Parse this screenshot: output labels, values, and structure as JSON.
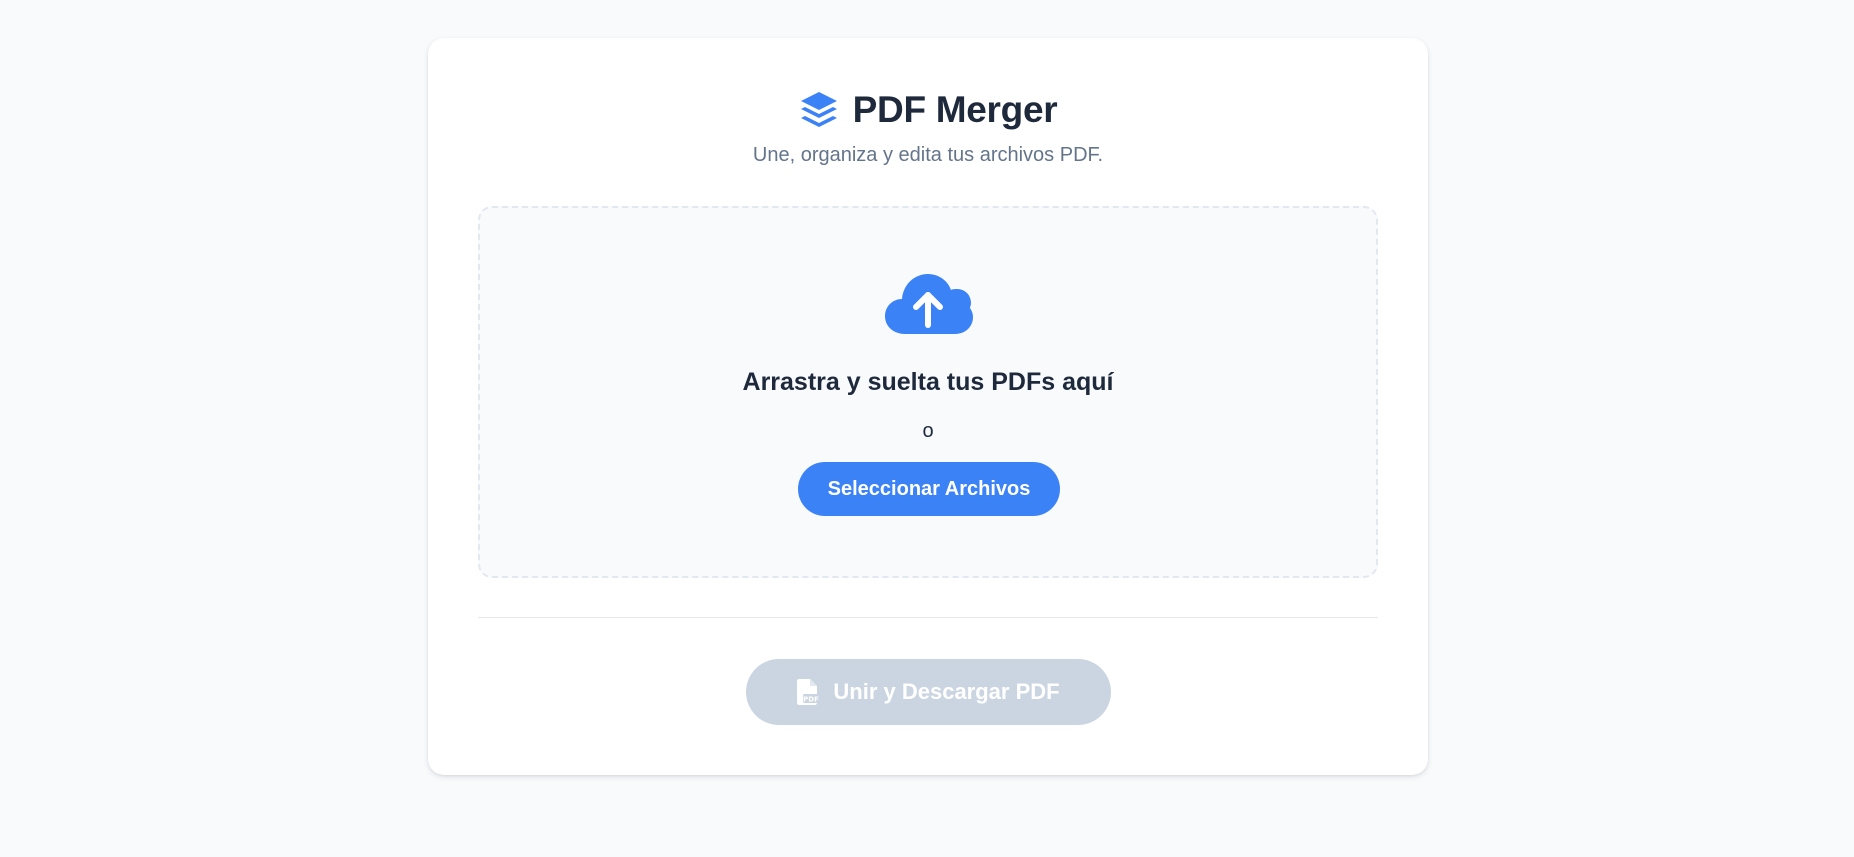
{
  "app": {
    "title": "PDF Merger",
    "subtitle": "Une, organiza y edita tus archivos PDF.",
    "logo_icon": "layers-icon"
  },
  "dropzone": {
    "icon": "cloud-upload-icon",
    "heading": "Arrastra y suelta tus PDFs aquí",
    "or_text": "o",
    "select_label": "Seleccionar Archivos"
  },
  "actions": {
    "merge_icon": "file-pdf-icon",
    "merge_label": "Unir y Descargar PDF",
    "merge_enabled": false
  },
  "colors": {
    "accent": "#3b82f6",
    "title_text": "#1e293b",
    "muted_text": "#64748b",
    "disabled_button": "#cbd5e1",
    "background": "#f8fafc"
  }
}
